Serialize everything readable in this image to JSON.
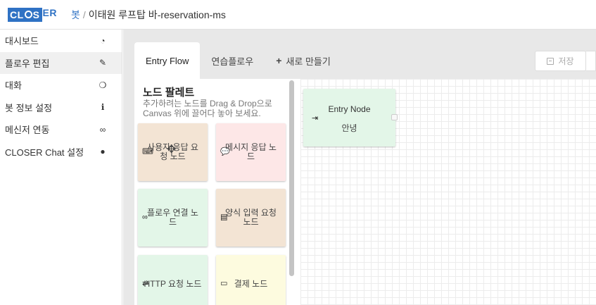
{
  "header": {
    "logo_first": "CL",
    "logo_middle": "S",
    "logo_rest": "ER",
    "breadcrumb_root": "봇",
    "breadcrumb_sep": "/",
    "breadcrumb_current": "이태원 루프탑 바-reservation-ms"
  },
  "sidebar": {
    "items": [
      {
        "label": "대시보드",
        "icon": "dashboard-icon",
        "glyph": "◔"
      },
      {
        "label": "플로우 편집",
        "icon": "pencil-icon",
        "glyph": "✎"
      },
      {
        "label": "대화",
        "icon": "chat-icon",
        "glyph": "❍"
      },
      {
        "label": "봇 정보 설정",
        "icon": "info-icon",
        "glyph": "ℹ"
      },
      {
        "label": "메신저 연동",
        "icon": "link-icon",
        "glyph": "∞"
      },
      {
        "label": "CLOSER Chat 설정",
        "icon": "user-icon",
        "glyph": "●"
      }
    ]
  },
  "tabs": {
    "entry": "Entry Flow",
    "practice": "연습플로우",
    "new_plus": "+",
    "new": "새로 만들기"
  },
  "toolbar": {
    "save_label": "저장"
  },
  "palette": {
    "title": "노드 팔레트",
    "description": "추가하려는 노드를 Drag & Drop으로 Canvas 위에 끌어다 놓아 보세요.",
    "nodes": [
      {
        "label": "사용자 응답 요청 노드",
        "icon": "keyboard-icon",
        "glyph": "⌨",
        "color": "#f3e4d4"
      },
      {
        "label": "메시지 응답 노드",
        "icon": "speech-bubble-icon",
        "glyph": "💬",
        "color": "#fde7e7"
      },
      {
        "label": "플로우 연결 노드",
        "icon": "link-icon",
        "glyph": "∞",
        "color": "#e3f6e8"
      },
      {
        "label": "양식 입력 요청 노드",
        "icon": "form-icon",
        "glyph": "▤",
        "color": "#f3e4d4"
      },
      {
        "label": "HTTP 요청 노드",
        "icon": "exchange-icon",
        "glyph": "⇄",
        "color": "#e3f6e8"
      },
      {
        "label": "결제 노드",
        "icon": "credit-card-icon",
        "glyph": "▭",
        "color": "#fdfbdf"
      }
    ]
  },
  "canvas": {
    "entry_node": {
      "title": "Entry Node",
      "subtitle": "안녕",
      "icon": "sign-in-icon",
      "glyph": "⇥"
    }
  },
  "cursor": {
    "icon": "move-cursor-icon",
    "glyph": "✥"
  }
}
